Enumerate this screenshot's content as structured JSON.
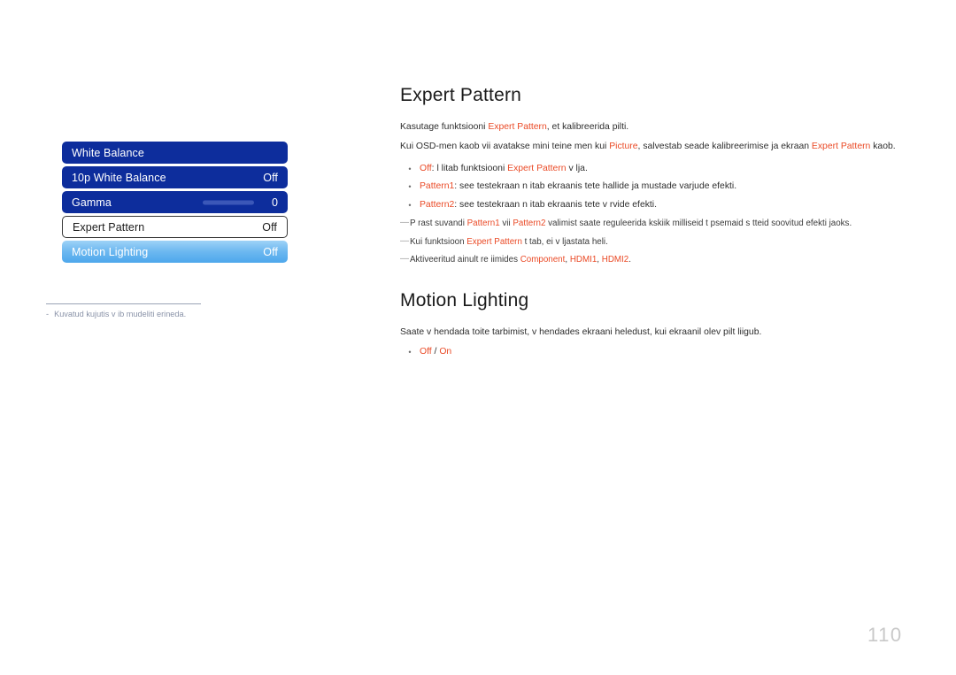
{
  "osd_menu": {
    "rows": [
      {
        "label": "White Balance",
        "value": "",
        "style": "dark",
        "slider": false
      },
      {
        "label": "10p White Balance",
        "value": "Off",
        "style": "dark",
        "slider": false
      },
      {
        "label": "Gamma",
        "value": "0",
        "style": "dark",
        "slider": true
      },
      {
        "label": "Expert Pattern",
        "value": "Off",
        "style": "selected",
        "slider": false
      },
      {
        "label": "Motion Lighting",
        "value": "Off",
        "style": "highlight",
        "slider": false
      }
    ],
    "footnote": {
      "dash": "-",
      "text": "Kuvatud kujutis v ib mudeliti erineda."
    }
  },
  "sections": [
    {
      "title": "Expert Pattern",
      "paragraphs": [
        [
          {
            "t": "Kasutage funktsiooni ",
            "c": "n"
          },
          {
            "t": "Expert Pattern",
            "c": "h"
          },
          {
            "t": ", et kalibreerida pilti.",
            "c": "n"
          }
        ],
        [
          {
            "t": "Kui OSD-men  kaob vii avatakse mini teine men  kui ",
            "c": "n"
          },
          {
            "t": "Picture",
            "c": "h"
          },
          {
            "t": ", salvestab seade kalibreerimise ja ekraan ",
            "c": "n"
          },
          {
            "t": "Expert Pattern",
            "c": "h"
          },
          {
            "t": " kaob.",
            "c": "n"
          }
        ]
      ],
      "bullets": [
        [
          {
            "t": "Off",
            "c": "h"
          },
          {
            "t": ": l litab funktsiooni ",
            "c": "n"
          },
          {
            "t": "Expert Pattern",
            "c": "h"
          },
          {
            "t": " v lja.",
            "c": "n"
          }
        ],
        [
          {
            "t": "Pattern1",
            "c": "h"
          },
          {
            "t": ": see testekraan n itab ekraanis tete hallide ja mustade varjude efekti.",
            "c": "n"
          }
        ],
        [
          {
            "t": "Pattern2",
            "c": "h"
          },
          {
            "t": ": see testekraan n itab ekraanis tete v rvide efekti.",
            "c": "n"
          }
        ]
      ],
      "notes": [
        [
          {
            "t": "P rast suvandi ",
            "c": "n"
          },
          {
            "t": "Pattern1",
            "c": "h"
          },
          {
            "t": " vii ",
            "c": "n"
          },
          {
            "t": "Pattern2",
            "c": "h"
          },
          {
            "t": " valimist saate reguleerida  kskiik milliseid t psemaid s tteid soovitud efekti jaoks.",
            "c": "n"
          }
        ],
        [
          {
            "t": "Kui funktsioon ",
            "c": "n"
          },
          {
            "t": "Expert Pattern",
            "c": "h"
          },
          {
            "t": " t tab, ei v ljastata heli.",
            "c": "n"
          }
        ],
        [
          {
            "t": "Aktiveeritud ainult re iimides ",
            "c": "n"
          },
          {
            "t": "Component",
            "c": "h"
          },
          {
            "t": ", ",
            "c": "n"
          },
          {
            "t": "HDMI1",
            "c": "h"
          },
          {
            "t": ", ",
            "c": "n"
          },
          {
            "t": "HDMI2",
            "c": "h"
          },
          {
            "t": ".",
            "c": "n"
          }
        ]
      ]
    },
    {
      "title": "Motion Lighting",
      "paragraphs": [
        [
          {
            "t": "Saate v hendada toite tarbimist, v hendades ekraani heledust, kui ekraanil olev pilt liigub.",
            "c": "n"
          }
        ]
      ],
      "bullets": [
        [
          {
            "t": "Off",
            "c": "h"
          },
          {
            "t": " / ",
            "c": "n"
          },
          {
            "t": "On",
            "c": "h"
          }
        ]
      ],
      "notes": []
    }
  ],
  "bullet_glyph": "•",
  "note_glyph": "—",
  "page_number": "110",
  "colors": {
    "highlight": "#ea4a26",
    "menu_dark": "#0d2d9c",
    "menu_highlight": "#6cb8f0",
    "page_number": "#c9c9c9",
    "footnote": "#8a93a8"
  }
}
